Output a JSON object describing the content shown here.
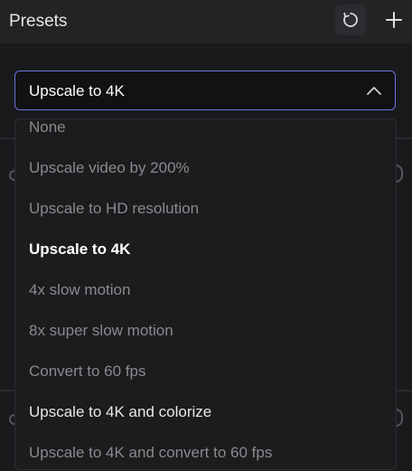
{
  "header": {
    "title": "Presets",
    "refresh_icon": "refresh-icon",
    "add_icon": "plus-icon"
  },
  "select": {
    "value": "Upscale to 4K",
    "state": "expanded",
    "accent_color": "#6b72d8"
  },
  "options": [
    {
      "label": "None",
      "state": "normal"
    },
    {
      "label": "Upscale video by 200%",
      "state": "normal"
    },
    {
      "label": "Upscale to HD resolution",
      "state": "normal"
    },
    {
      "label": "Upscale to 4K",
      "state": "selected"
    },
    {
      "label": "4x slow motion",
      "state": "normal"
    },
    {
      "label": "8x super slow motion",
      "state": "normal"
    },
    {
      "label": "Convert to 60 fps",
      "state": "normal"
    },
    {
      "label": "Upscale to 4K and colorize",
      "state": "hover"
    },
    {
      "label": "Upscale to 4K and convert to 60 fps",
      "state": "normal"
    }
  ]
}
